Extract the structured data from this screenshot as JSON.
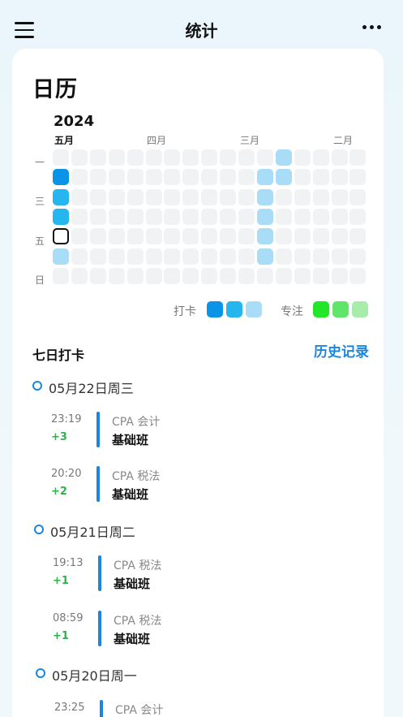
{
  "header": {
    "title": "统计",
    "menu_icon": "hamburger-icon",
    "more_icon": "more-dots-icon"
  },
  "calendar": {
    "title": "日历",
    "year": "2024",
    "months": [
      {
        "label": "五月",
        "current": true
      },
      {
        "label": "四月",
        "current": false
      },
      {
        "label": "三月",
        "current": false
      },
      {
        "label": "二月",
        "current": false
      }
    ],
    "weekdays": [
      "一",
      "三",
      "五",
      "日"
    ],
    "weeks": 17,
    "days_per_week": 7,
    "colors": {
      "empty": "#f1f2f3",
      "level3": "#0b93e8",
      "level2": "#25b6ef",
      "level1": "#a9dcf7"
    },
    "active_cells": [
      {
        "week": 0,
        "day": 1,
        "level": 3
      },
      {
        "week": 0,
        "day": 2,
        "level": 2
      },
      {
        "week": 0,
        "day": 3,
        "level": 2
      },
      {
        "week": 0,
        "day": 4,
        "level": 0,
        "today": true
      },
      {
        "week": 0,
        "day": 5,
        "level": 1
      },
      {
        "week": 11,
        "day": 1,
        "level": 1
      },
      {
        "week": 11,
        "day": 2,
        "level": 1
      },
      {
        "week": 11,
        "day": 3,
        "level": 1
      },
      {
        "week": 11,
        "day": 4,
        "level": 1
      },
      {
        "week": 11,
        "day": 5,
        "level": 1
      },
      {
        "week": 12,
        "day": 0,
        "level": 1
      },
      {
        "week": 12,
        "day": 1,
        "level": 1
      }
    ]
  },
  "legend": {
    "checkin_label": "打卡",
    "checkin_colors": [
      "#0b93e8",
      "#25b6ef",
      "#a9dcf7"
    ],
    "focus_label": "专注",
    "focus_colors": [
      "#22e62a",
      "#5fe66a",
      "#a6ecaa"
    ]
  },
  "checkins": {
    "title": "七日打卡",
    "history_link": "历史记录",
    "days": [
      {
        "label": "05月22日周三",
        "entries": [
          {
            "time": "23:19",
            "points": "+3",
            "category": "CPA 会计",
            "course": "基础班"
          },
          {
            "time": "20:20",
            "points": "+2",
            "category": "CPA 税法",
            "course": "基础班"
          }
        ]
      },
      {
        "label": "05月21日周二",
        "entries": [
          {
            "time": "19:13",
            "points": "+1",
            "category": "CPA 税法",
            "course": "基础班"
          },
          {
            "time": "08:59",
            "points": "+1",
            "category": "CPA 税法",
            "course": "基础班"
          }
        ]
      },
      {
        "label": "05月20日周一",
        "entries": [
          {
            "time": "23:25",
            "points": "",
            "category": "CPA 会计",
            "course": ""
          }
        ]
      }
    ]
  }
}
